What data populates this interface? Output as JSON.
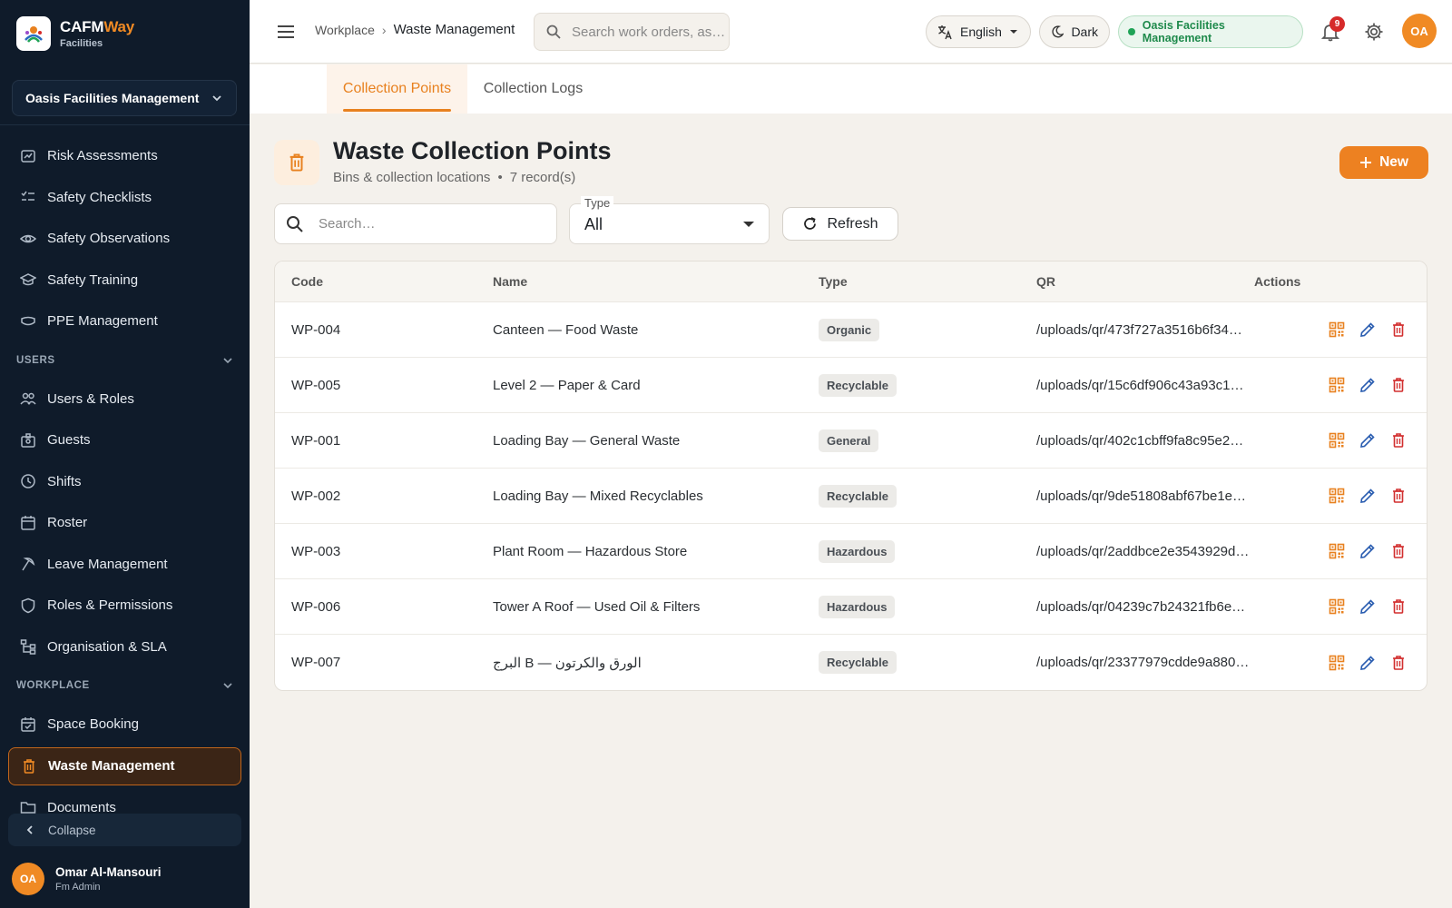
{
  "brand": {
    "name_main": "CAFM",
    "name_accent": "Way",
    "subtitle": "Facilities"
  },
  "sidebar": {
    "org_selector": "Oasis Facilities Management",
    "items_top": [
      {
        "label": "Risk Assessments",
        "icon": "risk-icon"
      },
      {
        "label": "Safety Checklists",
        "icon": "checklist-icon"
      },
      {
        "label": "Safety Observations",
        "icon": "eye-icon"
      },
      {
        "label": "Safety Training",
        "icon": "graduation-cap-icon"
      },
      {
        "label": "PPE Management",
        "icon": "mask-icon"
      }
    ],
    "section_users": "USERS",
    "items_users": [
      {
        "label": "Users & Roles",
        "icon": "people-icon"
      },
      {
        "label": "Guests",
        "icon": "badge-icon"
      },
      {
        "label": "Shifts",
        "icon": "clock-icon"
      },
      {
        "label": "Roster",
        "icon": "calendar-icon"
      },
      {
        "label": "Leave Management",
        "icon": "leave-icon"
      },
      {
        "label": "Roles & Permissions",
        "icon": "shield-icon"
      },
      {
        "label": "Organisation & SLA",
        "icon": "org-chart-icon"
      }
    ],
    "section_workplace": "WORKPLACE",
    "items_workplace": [
      {
        "label": "Space Booking",
        "icon": "calendar-check-icon"
      },
      {
        "label": "Waste Management",
        "icon": "trash-icon",
        "active": true
      },
      {
        "label": "Documents",
        "icon": "folder-icon"
      }
    ],
    "collapse_label": "Collapse",
    "user": {
      "initials": "OA",
      "name": "Omar Al-Mansouri",
      "role": "Fm Admin"
    }
  },
  "topbar": {
    "breadcrumb_parent": "Workplace",
    "breadcrumb_sep": "›",
    "breadcrumb_current": "Waste Management",
    "search_placeholder": "Search work orders, as…",
    "language": "English",
    "theme": "Dark",
    "org": "Oasis Facilities Management",
    "notification_count": "9",
    "avatar_initials": "OA"
  },
  "tabs": [
    {
      "label": "Collection Points",
      "active": true
    },
    {
      "label": "Collection Logs",
      "active": false
    }
  ],
  "page": {
    "title": "Waste Collection Points",
    "subtitle": "Bins & collection locations",
    "bullet": "•",
    "record_count": "7 record(s)",
    "new_button": "New"
  },
  "filters": {
    "search_placeholder": "Search…",
    "type_label": "Type",
    "type_value": "All",
    "refresh_button": "Refresh"
  },
  "table": {
    "columns": [
      "Code",
      "Name",
      "Type",
      "QR",
      "Actions"
    ],
    "rows": [
      {
        "code": "WP-004",
        "name": "Canteen — Food Waste",
        "type": "Organic",
        "qr": "/uploads/qr/473f727a3516b6f34…"
      },
      {
        "code": "WP-005",
        "name": "Level 2 — Paper & Card",
        "type": "Recyclable",
        "qr": "/uploads/qr/15c6df906c43a93c1…"
      },
      {
        "code": "WP-001",
        "name": "Loading Bay — General Waste",
        "type": "General",
        "qr": "/uploads/qr/402c1cbff9fa8c95e2…"
      },
      {
        "code": "WP-002",
        "name": "Loading Bay — Mixed Recyclables",
        "type": "Recyclable",
        "qr": "/uploads/qr/9de51808abf67be1e…"
      },
      {
        "code": "WP-003",
        "name": "Plant Room — Hazardous Store",
        "type": "Hazardous",
        "qr": "/uploads/qr/2addbce2e3543929d…"
      },
      {
        "code": "WP-006",
        "name": "Tower A Roof — Used Oil & Filters",
        "type": "Hazardous",
        "qr": "/uploads/qr/04239c7b24321fb6e…"
      },
      {
        "code": "WP-007",
        "name": "البرج B — الورق والكرتون",
        "type": "Recyclable",
        "qr": "/uploads/qr/23377979cdde9a880…"
      }
    ]
  },
  "colors": {
    "accent": "#ed8121",
    "sidebar_bg": "#0f1b2a",
    "success": "#1f8a4c",
    "danger": "#d22f2f",
    "edit": "#2a5db0"
  }
}
